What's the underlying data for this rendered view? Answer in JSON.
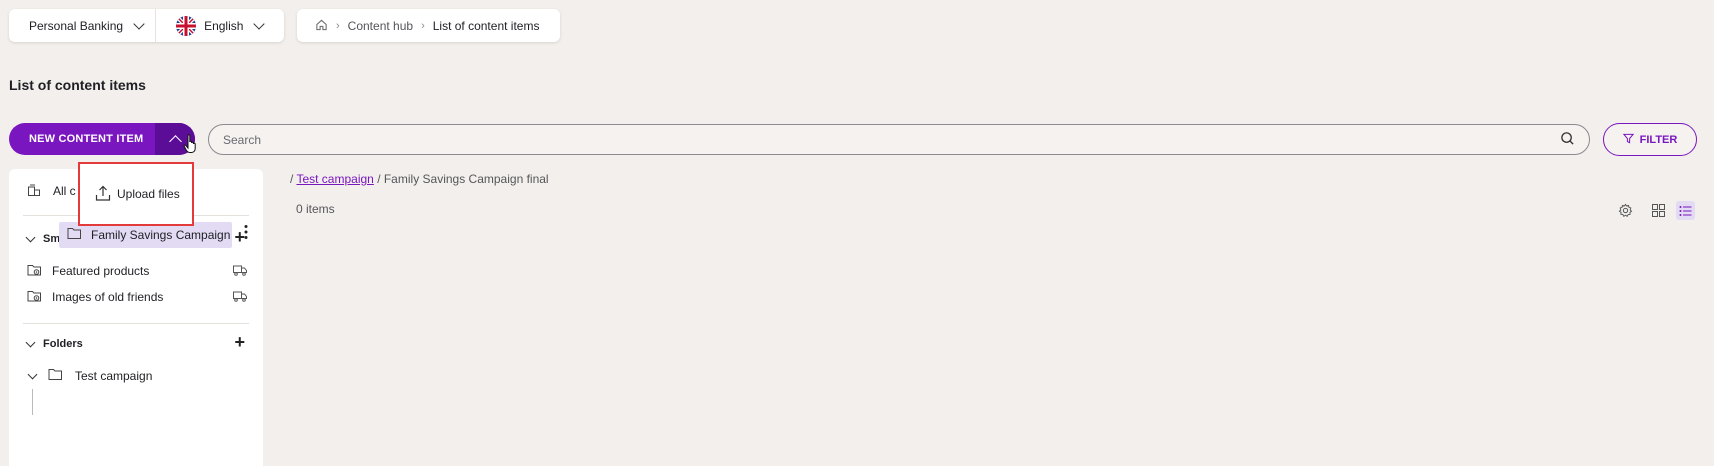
{
  "selectors": {
    "site": "Personal Banking",
    "language": "English"
  },
  "breadcrumb": {
    "items": [
      "Content hub",
      "List of content items"
    ]
  },
  "page": {
    "title": "List of content items"
  },
  "toolbar": {
    "new_item_label": "NEW CONTENT ITEM",
    "search_placeholder": "Search",
    "filter_label": "FILTER"
  },
  "dropdown": {
    "upload_label": "Upload files"
  },
  "sidebar": {
    "all_label": "All c",
    "smart_folders_title": "Smart folders",
    "smart_folders": [
      "Featured products",
      "Images of old friends"
    ],
    "folders_title": "Folders",
    "folders": [
      {
        "label": "Test campaign",
        "children": [
          "Family Savings Campaign final"
        ]
      }
    ]
  },
  "content": {
    "path_prefix": "/",
    "path_link": "Test campaign",
    "path_suffix": "/ Family Savings Campaign final",
    "item_count": "0 items"
  },
  "colors": {
    "accent": "#7a16bf",
    "accent_dark": "#5c0d97",
    "highlight": "#e33b3b",
    "selected_bg": "#e3dbf3",
    "page_bg": "#f3efec"
  },
  "icons": [
    "chevron-down-icon",
    "uk-flag-icon",
    "home-icon",
    "chevron-up-icon",
    "search-icon",
    "filter-icon",
    "upload-icon",
    "all-items-icon",
    "plus-icon",
    "smart-folder-icon",
    "truck-icon",
    "folder-icon",
    "kebab-icon",
    "settings-icon",
    "grid-view-icon",
    "list-view-icon"
  ]
}
